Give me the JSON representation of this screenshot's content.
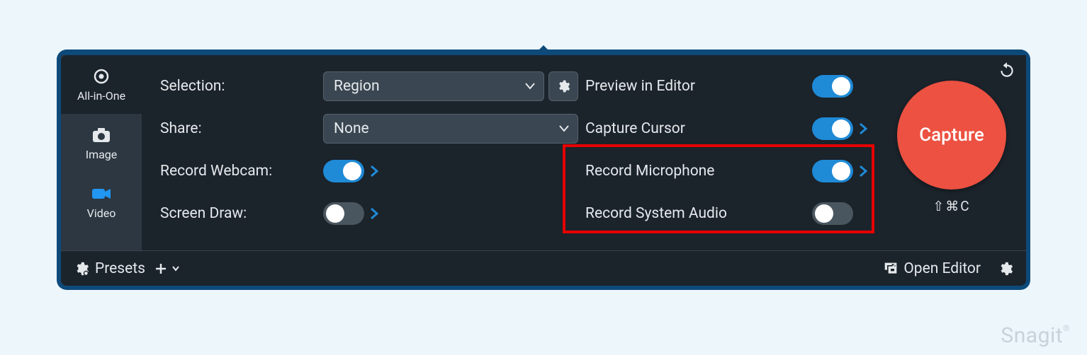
{
  "sidebar": {
    "items": [
      {
        "label": "All-in-One"
      },
      {
        "label": "Image"
      },
      {
        "label": "Video"
      }
    ],
    "active_index": 0
  },
  "settings": {
    "selection_label": "Selection:",
    "selection_value": "Region",
    "share_label": "Share:",
    "share_value": "None",
    "record_webcam_label": "Record Webcam:",
    "record_webcam_on": true,
    "screen_draw_label": "Screen Draw:",
    "screen_draw_on": false,
    "preview_label": "Preview in Editor",
    "preview_on": true,
    "capture_cursor_label": "Capture Cursor",
    "capture_cursor_on": true,
    "record_mic_label": "Record Microphone",
    "record_mic_on": true,
    "record_sysaudio_label": "Record System Audio",
    "record_sysaudio_on": false
  },
  "capture": {
    "label": "Capture",
    "shortcut": "⇧⌘C"
  },
  "footer": {
    "presets": "Presets",
    "open_editor": "Open Editor"
  },
  "watermark": "Snagit"
}
